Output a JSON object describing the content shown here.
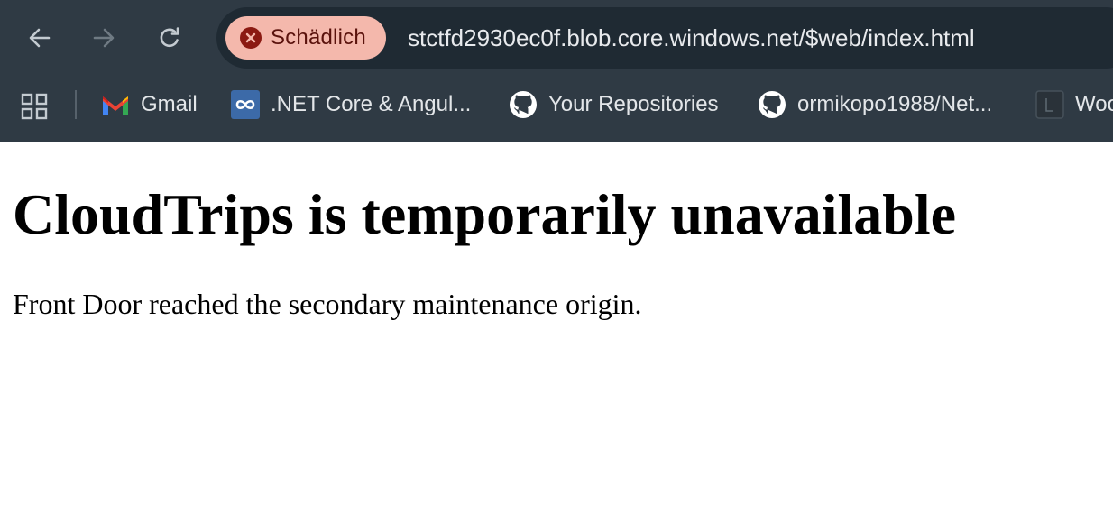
{
  "browser": {
    "nav": {
      "back_icon": "arrow-left-icon",
      "forward_icon": "arrow-right-icon",
      "reload_icon": "reload-icon"
    },
    "omnibox": {
      "security_label": "Schädlich",
      "security_icon": "error-x-icon",
      "security_color": "#f4b8ac",
      "url": "stctfd2930ec0f.blob.core.windows.net/$web/index.html"
    },
    "bookmarks": [
      {
        "label": "Gmail",
        "icon": "gmail-icon"
      },
      {
        "label": ".NET Core & Angul...",
        "icon": "infinity-icon"
      },
      {
        "label": "Your Repositories",
        "icon": "github-icon"
      },
      {
        "label": "ormikopo1988/Net...",
        "icon": "github-icon"
      },
      {
        "label": "Woo",
        "icon": "page-icon"
      }
    ]
  },
  "page": {
    "heading": "CloudTrips is temporarily unavailable",
    "body": "Front Door reached the secondary maintenance origin."
  }
}
